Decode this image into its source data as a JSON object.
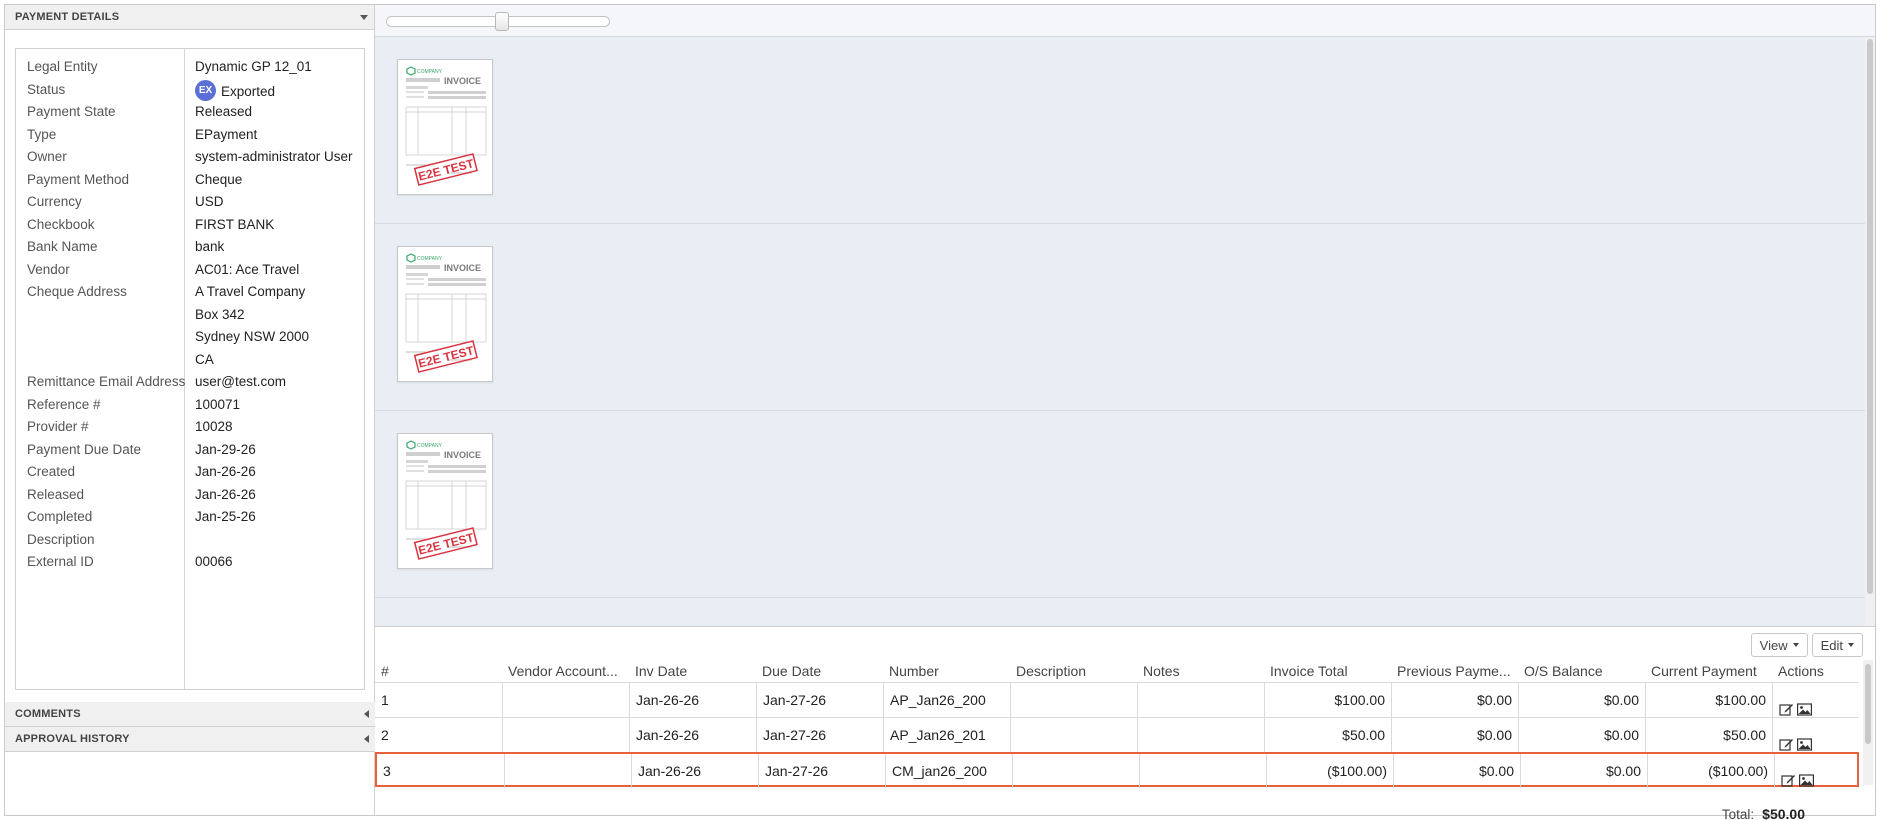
{
  "left": {
    "payment_details_header": "PAYMENT DETAILS",
    "comments_header": "COMMENTS",
    "approval_header": "APPROVAL HISTORY",
    "status_badge": "EX",
    "fields": [
      {
        "label": "Legal Entity",
        "value": "Dynamic GP 12_01"
      },
      {
        "label": "Status",
        "value": "Exported"
      },
      {
        "label": "Payment State",
        "value": "Released"
      },
      {
        "label": "Type",
        "value": "EPayment"
      },
      {
        "label": "Owner",
        "value": "system-administrator User"
      },
      {
        "label": "Payment Method",
        "value": "Cheque"
      },
      {
        "label": "Currency",
        "value": "USD"
      },
      {
        "label": "Checkbook",
        "value": "FIRST BANK"
      },
      {
        "label": "Bank Name",
        "value": "bank"
      },
      {
        "label": "Vendor",
        "value": "AC01: Ace Travel"
      },
      {
        "label": "Cheque Address",
        "value": "A Travel Company"
      },
      {
        "label": "",
        "value": "Box 342"
      },
      {
        "label": "",
        "value": "Sydney NSW 2000"
      },
      {
        "label": "",
        "value": "CA"
      },
      {
        "label": "Remittance Email Address",
        "value": "user@test.com"
      },
      {
        "label": "Reference #",
        "value": "100071"
      },
      {
        "label": "Provider #",
        "value": "10028"
      },
      {
        "label": "Payment Due Date",
        "value": "Jan-29-26"
      },
      {
        "label": "Created",
        "value": "Jan-26-26"
      },
      {
        "label": "Released",
        "value": "Jan-26-26"
      },
      {
        "label": "Completed",
        "value": "Jan-25-26"
      },
      {
        "label": "Description",
        "value": ""
      },
      {
        "label": "External ID",
        "value": "00066"
      }
    ]
  },
  "viewer": {
    "zoom_fraction": 0.52,
    "thumb": {
      "company": "COMPANY",
      "title": "INVOICE",
      "stamp": "E2E TEST"
    }
  },
  "grid": {
    "view_label": "View",
    "edit_label": "Edit",
    "columns": [
      "#",
      "Vendor Account...",
      "Inv Date",
      "Due Date",
      "Number",
      "Description",
      "Notes",
      "Invoice Total",
      "Previous Payme...",
      "O/S Balance",
      "Current Payment",
      "Actions"
    ],
    "rows": [
      {
        "num": "1",
        "vendor_account": "",
        "inv_date": "Jan-26-26",
        "due_date": "Jan-27-26",
        "number": "AP_Jan26_200",
        "description": "",
        "notes": "",
        "invoice_total": "$100.00",
        "previous_payment": "$0.00",
        "os_balance": "$0.00",
        "current_payment": "$100.00"
      },
      {
        "num": "2",
        "vendor_account": "",
        "inv_date": "Jan-26-26",
        "due_date": "Jan-27-26",
        "number": "AP_Jan26_201",
        "description": "",
        "notes": "",
        "invoice_total": "$50.00",
        "previous_payment": "$0.00",
        "os_balance": "$0.00",
        "current_payment": "$50.00"
      },
      {
        "num": "3",
        "vendor_account": "",
        "inv_date": "Jan-26-26",
        "due_date": "Jan-27-26",
        "number": "CM_jan26_200",
        "description": "",
        "notes": "",
        "invoice_total": "($100.00)",
        "previous_payment": "$0.00",
        "os_balance": "$0.00",
        "current_payment": "($100.00)"
      }
    ],
    "selected_row": 2,
    "total_label": "Total:",
    "total_value": "$50.00"
  },
  "colors": {
    "accent_selected": "#e8603c",
    "badge": "#5b6fd6",
    "stamp": "#d9333f",
    "logo": "#3aa76d"
  }
}
